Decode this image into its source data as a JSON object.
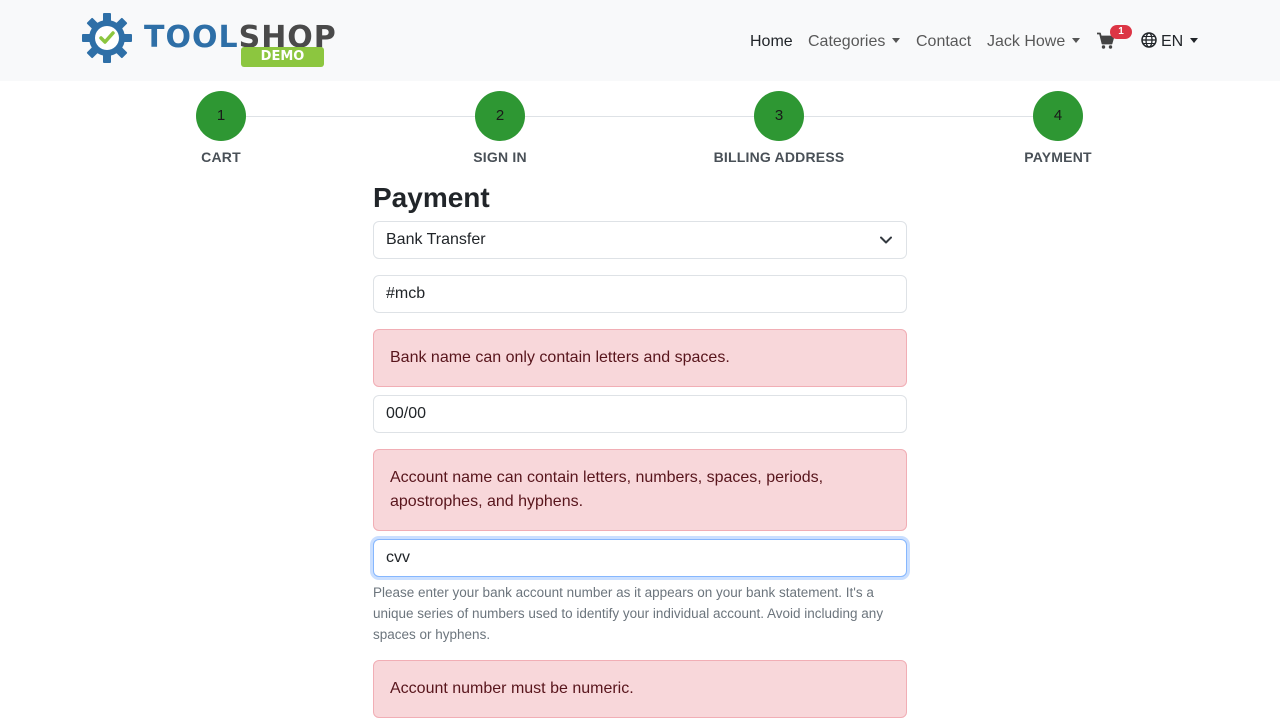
{
  "brand": {
    "name_part1": "TOOL",
    "name_part2": "SHOP",
    "badge": "DEMO",
    "colors": {
      "primary": "#2e6fa7",
      "dark": "#4a4a4a",
      "demo": "#8cc63f"
    }
  },
  "nav": {
    "home": "Home",
    "categories": "Categories",
    "contact": "Contact",
    "user": "Jack Howe",
    "cart_count": "1",
    "language": "EN"
  },
  "steps": [
    {
      "number": "1",
      "label": "CART"
    },
    {
      "number": "2",
      "label": "SIGN IN"
    },
    {
      "number": "3",
      "label": "BILLING ADDRESS"
    },
    {
      "number": "4",
      "label": "PAYMENT"
    }
  ],
  "step_color": "#2e9733",
  "payment": {
    "title": "Payment",
    "method_selected": "Bank Transfer",
    "bank_name_value": "#mcb",
    "bank_name_error": "Bank name can only contain letters and spaces.",
    "account_name_value": "00/00",
    "account_name_error": "Account name can contain letters, numbers, spaces, periods, apostrophes, and hyphens.",
    "account_number_value": "cvv",
    "account_number_help": "Please enter your bank account number as it appears on your bank statement. It's a unique series of numbers used to identify your individual account. Avoid including any spaces or hyphens.",
    "account_number_error": "Account number must be numeric."
  }
}
